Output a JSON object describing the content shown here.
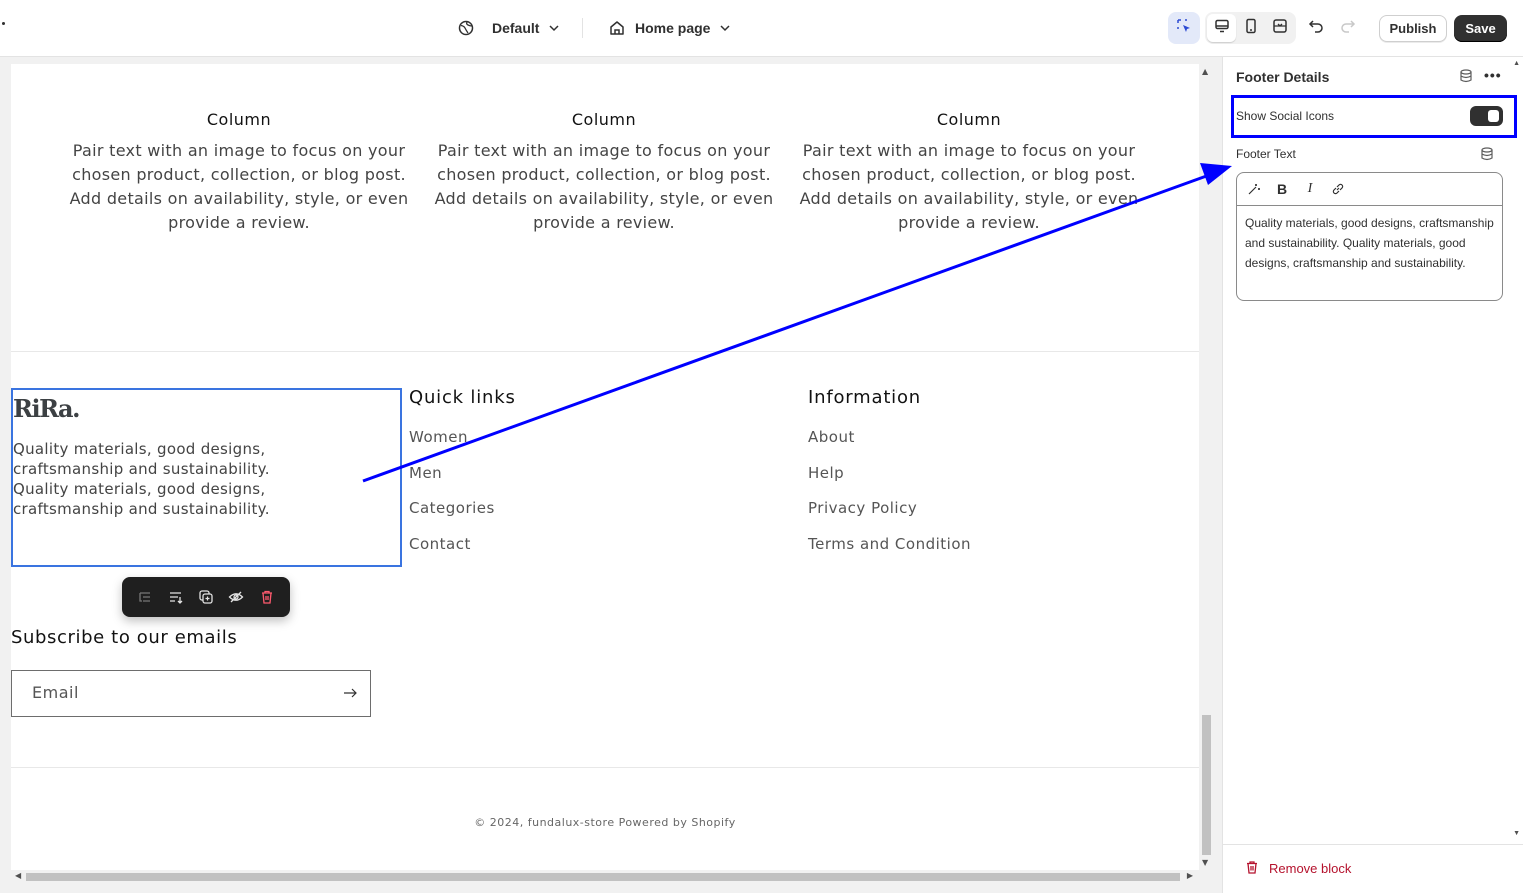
{
  "topbar": {
    "theme": "Default",
    "page": "Home page",
    "publish_label": "Publish",
    "save_label": "Save"
  },
  "preview": {
    "columns": [
      {
        "title": "Column",
        "text": "Pair text with an image to focus on your chosen product, collection, or blog post. Add details on availability, style, or even provide a review."
      },
      {
        "title": "Column",
        "text": "Pair text with an image to focus on your chosen product, collection, or blog post. Add details on availability, style, or even provide a review."
      },
      {
        "title": "Column",
        "text": "Pair text with an image to focus on your chosen product, collection, or blog post. Add details on availability, style, or even provide a review."
      }
    ],
    "brand": {
      "logo": "RiRa.",
      "text": "Quality materials, good designs, craftsmanship and sustainability. Quality materials, good designs, craftsmanship and sustainability."
    },
    "quick_links": {
      "title": "Quick links",
      "items": [
        "Women",
        "Men",
        "Categories",
        "Contact"
      ]
    },
    "information": {
      "title": "Information",
      "items": [
        "About",
        "Help",
        "Privacy Policy",
        "Terms and Condition"
      ]
    },
    "subscribe": {
      "title": "Subscribe to our emails",
      "email_placeholder": "Email"
    },
    "copyright": "© 2024, fundalux-store Powered by Shopify"
  },
  "panel": {
    "title": "Footer Details",
    "show_social_label": "Show Social Icons",
    "show_social_on": true,
    "footer_text_label": "Footer Text",
    "footer_text_value": "Quality materials, good designs, craftsmanship and sustainability. Quality materials, good designs, craftsmanship and sustainability.",
    "remove_label": "Remove block"
  },
  "colors": {
    "accent_selection": "#3a74e0",
    "annotation": "#0000ff",
    "danger": "#b5122d",
    "primary_button": "#303030"
  }
}
